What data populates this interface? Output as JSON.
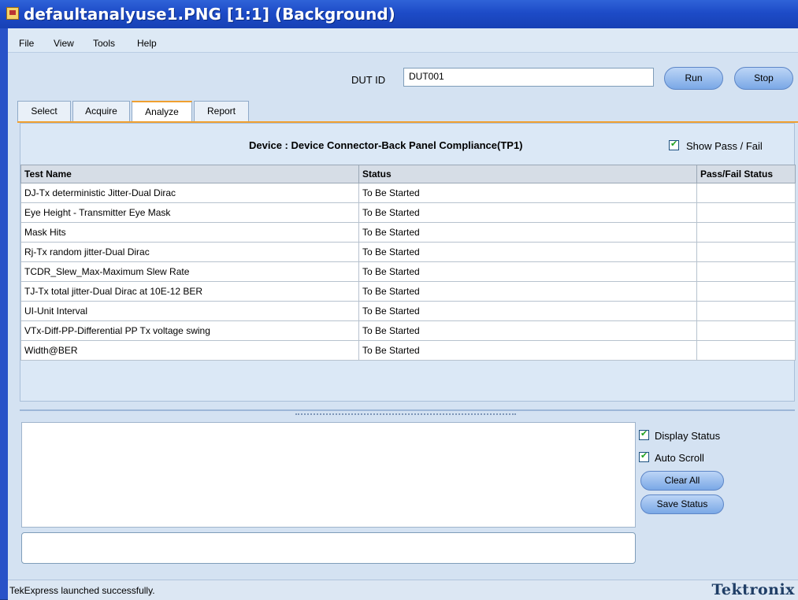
{
  "window": {
    "title": "defaultanalyuse1.PNG [1:1] (Background)",
    "icon": "image-file-icon"
  },
  "menu": [
    "File",
    "View",
    "Tools",
    "Help"
  ],
  "dut": {
    "label": "DUT ID",
    "value": "DUT001"
  },
  "buttons": {
    "run": "Run",
    "stop": "Stop",
    "clear_all": "Clear All",
    "save_status": "Save Status"
  },
  "tabs": [
    {
      "label": "Select",
      "active": false
    },
    {
      "label": "Acquire",
      "active": false
    },
    {
      "label": "Analyze",
      "active": true
    },
    {
      "label": "Report",
      "active": false
    }
  ],
  "device": {
    "title": "Device : Device Connector-Back Panel Compliance(TP1)"
  },
  "show_pass_fail": {
    "label": "Show Pass / Fail",
    "checked": true
  },
  "table": {
    "headers": [
      "Test Name",
      "Status",
      "Pass/Fail Status"
    ],
    "rows": [
      [
        "DJ-Tx deterministic Jitter-Dual Dirac",
        "To Be Started",
        ""
      ],
      [
        "Eye Height - Transmitter Eye Mask",
        "To Be Started",
        ""
      ],
      [
        "Mask Hits",
        "To Be Started",
        ""
      ],
      [
        "Rj-Tx random jitter-Dual Dirac",
        "To Be Started",
        ""
      ],
      [
        "TCDR_Slew_Max-Maximum Slew Rate",
        "To Be Started",
        ""
      ],
      [
        "TJ-Tx total jitter-Dual Dirac at 10E-12 BER",
        "To Be Started",
        ""
      ],
      [
        "UI-Unit Interval",
        "To Be Started",
        ""
      ],
      [
        "VTx-Diff-PP-Differential PP Tx voltage swing",
        "To Be Started",
        ""
      ],
      [
        "Width@BER",
        "To Be Started",
        ""
      ]
    ]
  },
  "options": {
    "display_status": {
      "label": "Display Status",
      "checked": true
    },
    "auto_scroll": {
      "label": "Auto Scroll",
      "checked": true
    }
  },
  "statusbar": {
    "text": "TekExpress launched successfully.",
    "brand": "Tektronix"
  },
  "colors": {
    "titlebar": "#1d4bc7",
    "tab_accent": "#f0a030",
    "check": "#21a121"
  }
}
